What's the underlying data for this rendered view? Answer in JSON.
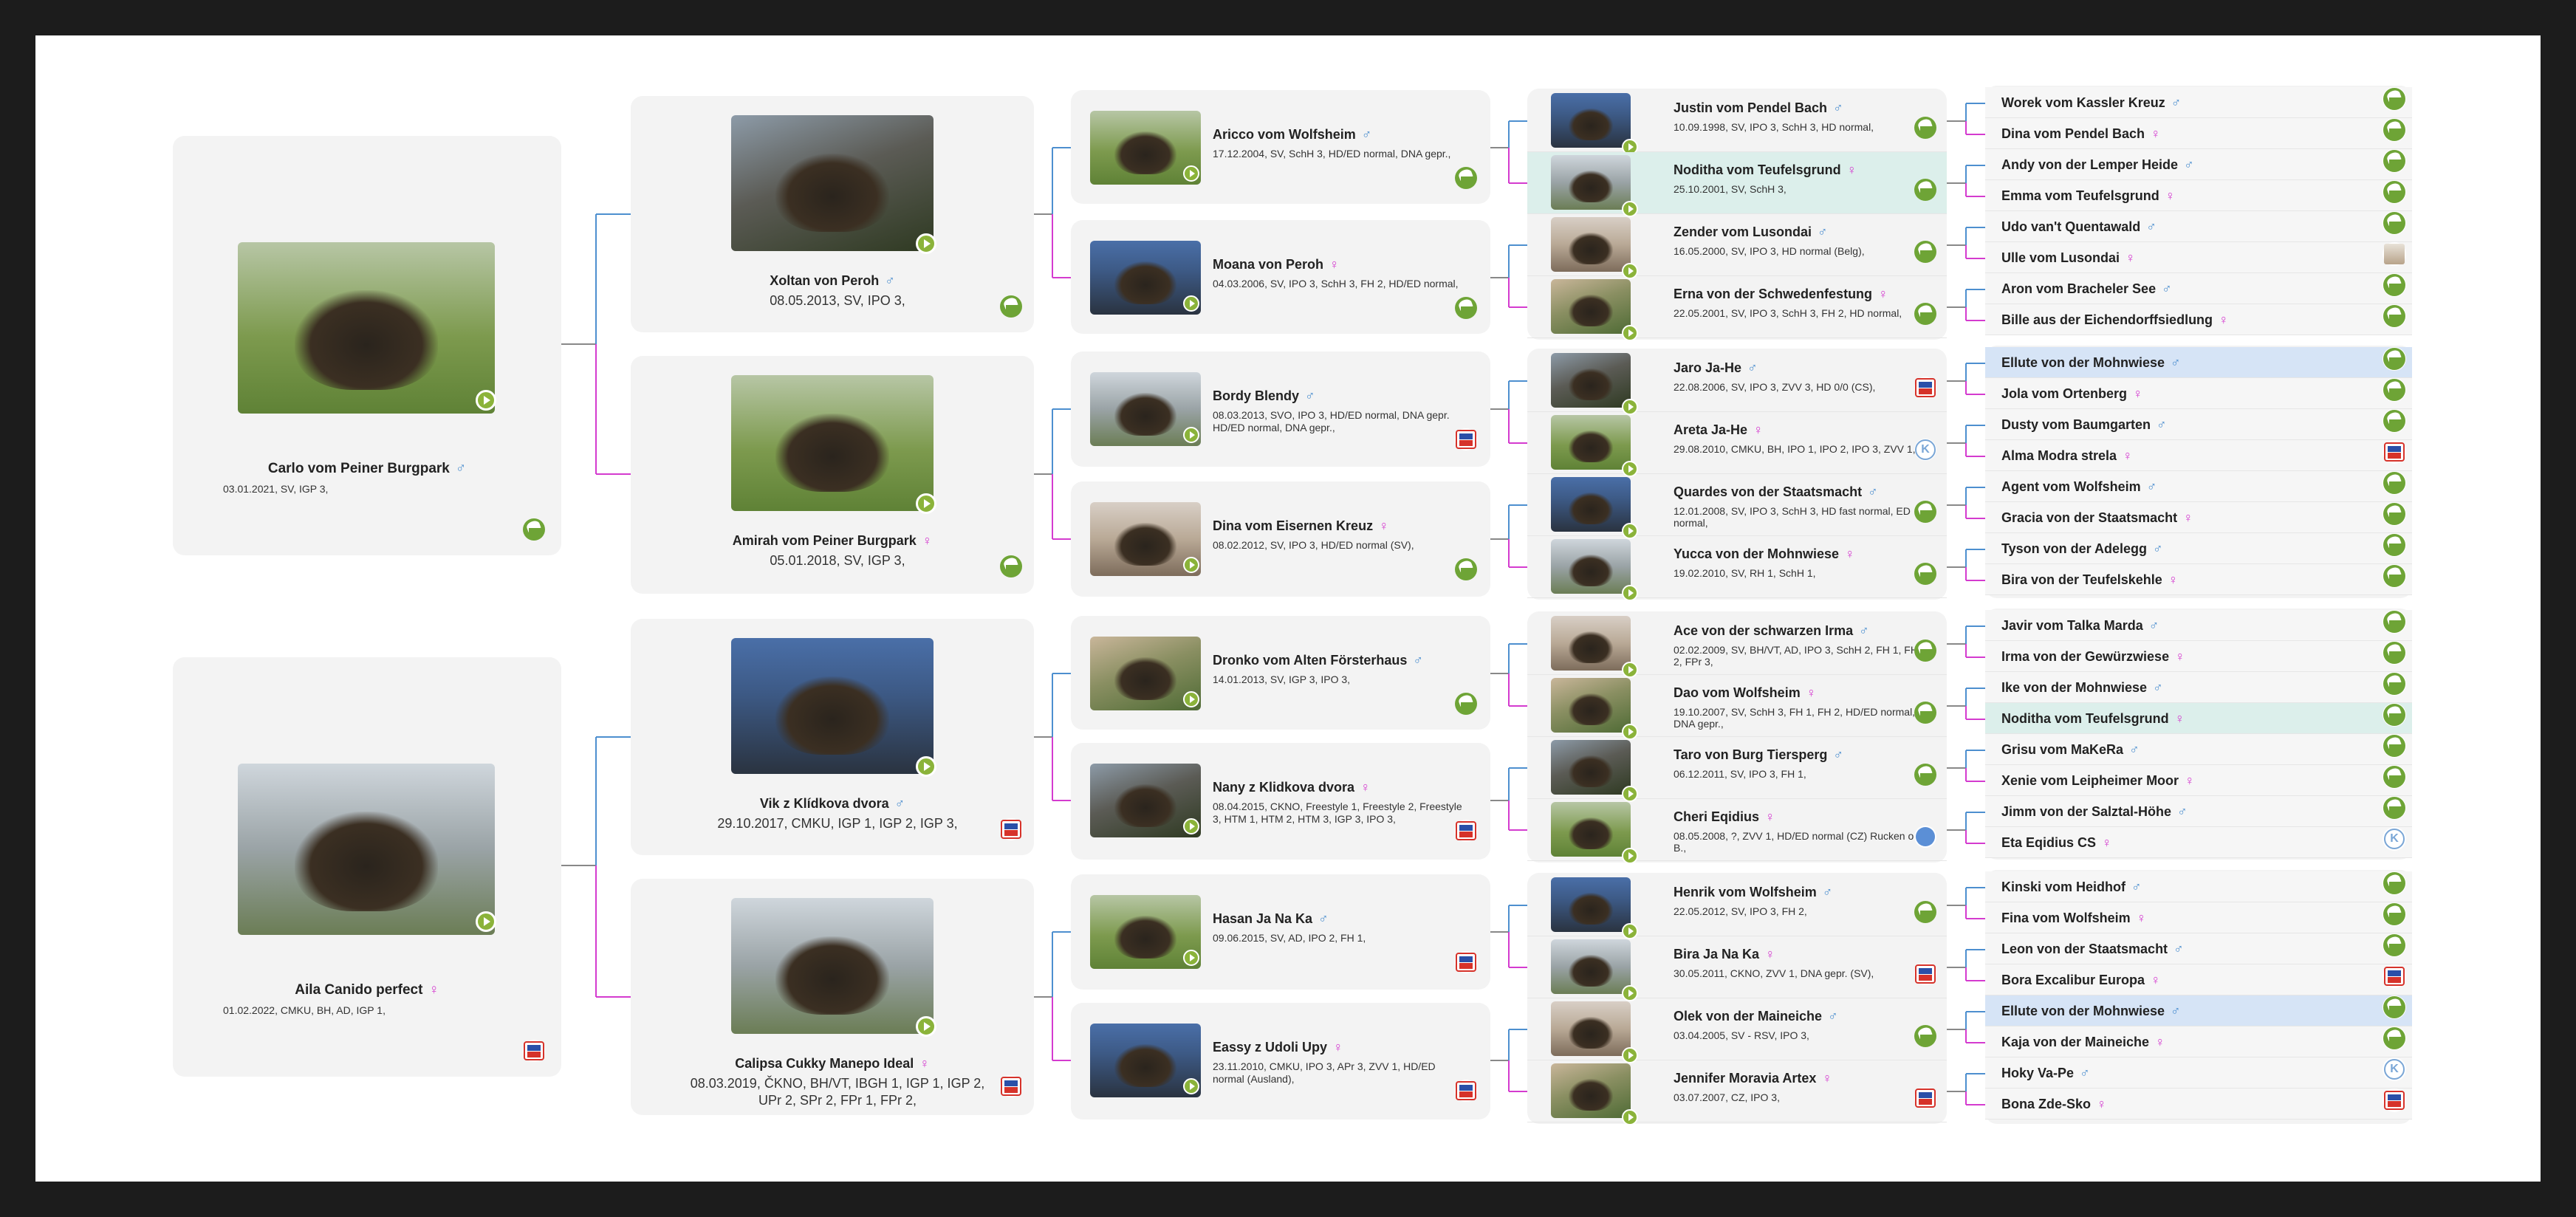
{
  "gen1": [
    {
      "name": "Carlo vom Peiner Burgpark",
      "sex": "♂",
      "info": "03.01.2021, SV, IGP 3,",
      "badge": "sv-icon"
    },
    {
      "name": "Aila Canido perfect",
      "sex": "♀",
      "info": "01.02.2022, CMKU, BH, AD, IGP 1,",
      "badge": "cz-icon"
    }
  ],
  "gen2": [
    {
      "name": "Xoltan von Peroh",
      "sex": "♂",
      "info": "08.05.2013, SV, IPO 3,",
      "badge": "sv-icon"
    },
    {
      "name": "Amirah vom Peiner Burgpark",
      "sex": "♀",
      "info": "05.01.2018, SV, IGP 3,",
      "badge": "sv-icon"
    },
    {
      "name": "Vik z Klídkova dvora",
      "sex": "♂",
      "info": "29.10.2017, CMKU, IGP 1, IGP 2, IGP 3,",
      "badge": "cz-icon"
    },
    {
      "name": "Calipsa Cukky Manepo Ideal",
      "sex": "♀",
      "info": "08.03.2019, ČKNO, BH/VT, IBGH 1, IGP 1, IGP 2, UPr 2, SPr 2, FPr 1, FPr 2,",
      "badge": "cz-icon"
    }
  ],
  "gen3": [
    {
      "name": "Aricco vom Wolfsheim",
      "sex": "♂",
      "info": "17.12.2004, SV, SchH 3, HD/ED normal, DNA gepr.,",
      "badge": "sv-icon"
    },
    {
      "name": "Moana von Peroh",
      "sex": "♀",
      "info": "04.03.2006, SV, IPO 3, SchH 3, FH 2, HD/ED normal,",
      "badge": "sv-icon"
    },
    {
      "name": "Bordy Blendy",
      "sex": "♂",
      "info": "08.03.2013, SVO, IPO 3, HD/ED normal, DNA gepr. HD/ED normal, DNA gepr.,",
      "badge": "cz-icon"
    },
    {
      "name": "Dina vom Eisernen Kreuz",
      "sex": "♀",
      "info": "08.02.2012, SV, IPO 3, HD/ED normal (SV),",
      "badge": "sv-icon"
    },
    {
      "name": "Dronko vom Alten Försterhaus",
      "sex": "♂",
      "info": "14.01.2013, SV, IGP 3, IPO 3,",
      "badge": "sv-icon"
    },
    {
      "name": "Nany z Klidkova dvora",
      "sex": "♀",
      "info": "08.04.2015, CKNO, Freestyle 1, Freestyle 2, Freestyle 3, HTM 1, HTM 2, HTM 3, IGP 3, IPO 3,",
      "badge": "cz-icon"
    },
    {
      "name": "Hasan Ja Na Ka",
      "sex": "♂",
      "info": "09.06.2015, SV, AD, IPO 2, FH 1,",
      "badge": "cz-icon"
    },
    {
      "name": "Eassy z Udoli Upy",
      "sex": "♀",
      "info": "23.11.2010, CMKU, IPO 3, APr 3, ZVV 1, HD/ED normal (Ausland),",
      "badge": "cz-icon"
    }
  ],
  "gen4": [
    {
      "name": "Justin vom Pendel Bach",
      "sex": "♂",
      "info": "10.09.1998, SV, IPO 3, SchH 3, HD normal,",
      "badge": "sv-icon",
      "hl": ""
    },
    {
      "name": "Noditha vom Teufelsgrund",
      "sex": "♀",
      "info": "25.10.2001, SV, SchH 3,",
      "badge": "sv-icon",
      "hl": "teal"
    },
    {
      "name": "Zender vom Lusondai",
      "sex": "♂",
      "info": "16.05.2000, SV, IPO 3, HD normal (Belg),",
      "badge": "sv-icon",
      "hl": ""
    },
    {
      "name": "Erna von der Schwedenfestung",
      "sex": "♀",
      "info": "22.05.2001, SV, IPO 3, SchH 3, FH 2, HD normal,",
      "badge": "sv-icon",
      "hl": ""
    },
    {
      "name": "Jaro Ja-He",
      "sex": "♂",
      "info": "22.08.2006, SV, IPO 3, ZVV 3, HD 0/0 (CS),",
      "badge": "cz-icon",
      "hl": ""
    },
    {
      "name": "Areta Ja-He",
      "sex": "♀",
      "info": "29.08.2010, CMKU, BH, IPO 1, IPO 2, IPO 3, ZVV 1,",
      "badge": "k-icon",
      "hl": ""
    },
    {
      "name": "Quardes von der Staatsmacht",
      "sex": "♂",
      "info": "12.01.2008, SV, IPO 3, SchH 3, HD fast normal, ED normal,",
      "badge": "sv-icon",
      "hl": ""
    },
    {
      "name": "Yucca von der Mohnwiese",
      "sex": "♀",
      "info": "19.02.2010, SV, RH 1, SchH 1,",
      "badge": "sv-icon",
      "hl": ""
    },
    {
      "name": "Ace von der schwarzen Irma",
      "sex": "♂",
      "info": "02.02.2009, SV, BH/VT, AD, IPO 3, SchH 2, FH 1, FH 2, FPr 3,",
      "badge": "sv-icon",
      "hl": ""
    },
    {
      "name": "Dao vom Wolfsheim",
      "sex": "♀",
      "info": "19.10.2007, SV, SchH 3, FH 1, FH 2, HD/ED normal, DNA gepr.,",
      "badge": "sv-icon",
      "hl": ""
    },
    {
      "name": "Taro von Burg Tiersperg",
      "sex": "♂",
      "info": "06.12.2011, SV, IPO 3, FH 1,",
      "badge": "sv-icon",
      "hl": ""
    },
    {
      "name": "Cheri Eqidius",
      "sex": "♀",
      "info": "08.05.2008, ?, ZVV 1, HD/ED normal (CZ) Rucken o. B.,",
      "badge": "blue-icon",
      "hl": ""
    },
    {
      "name": "Henrik vom Wolfsheim",
      "sex": "♂",
      "info": "22.05.2012, SV, IPO 3, FH 2,",
      "badge": "sv-icon",
      "hl": ""
    },
    {
      "name": "Bira Ja Na Ka",
      "sex": "♀",
      "info": "30.05.2011, CKNO, ZVV 1, DNA gepr. (SV),",
      "badge": "cz-icon",
      "hl": ""
    },
    {
      "name": "Olek von der Maineiche",
      "sex": "♂",
      "info": "03.04.2005, SV - RSV, IPO 3,",
      "badge": "sv-icon",
      "hl": ""
    },
    {
      "name": "Jennifer Moravia Artex",
      "sex": "♀",
      "info": "03.07.2007, CZ, IPO 3,",
      "badge": "cz-icon",
      "hl": ""
    }
  ],
  "gen5": [
    {
      "name": "Worek vom Kassler Kreuz",
      "sex": "♂",
      "badge": "sv-icon",
      "hl": ""
    },
    {
      "name": "Dina vom Pendel Bach",
      "sex": "♀",
      "badge": "sv-icon",
      "hl": ""
    },
    {
      "name": "Andy von der Lemper Heide",
      "sex": "♂",
      "badge": "sv-icon",
      "hl": ""
    },
    {
      "name": "Emma vom Teufelsgrund",
      "sex": "♀",
      "badge": "sv-icon",
      "hl": ""
    },
    {
      "name": "Udo van't Quentawald",
      "sex": "♂",
      "badge": "sv-icon",
      "hl": ""
    },
    {
      "name": "Ulle vom Lusondai",
      "sex": "♀",
      "badge": "photo-icon",
      "hl": ""
    },
    {
      "name": "Aron vom Bracheler See",
      "sex": "♂",
      "badge": "sv-icon",
      "hl": ""
    },
    {
      "name": "Bille aus der Eichendorffsiedlung",
      "sex": "♀",
      "badge": "sv-icon",
      "hl": ""
    },
    {
      "name": "Ellute von der Mohnwiese",
      "sex": "♂",
      "badge": "sv-icon",
      "hl": "blue"
    },
    {
      "name": "Jola vom Ortenberg",
      "sex": "♀",
      "badge": "sv-icon",
      "hl": ""
    },
    {
      "name": "Dusty vom Baumgarten",
      "sex": "♂",
      "badge": "sv-icon",
      "hl": ""
    },
    {
      "name": "Alma Modra strela",
      "sex": "♀",
      "badge": "cz-icon",
      "hl": ""
    },
    {
      "name": "Agent vom Wolfsheim",
      "sex": "♂",
      "badge": "sv-icon",
      "hl": ""
    },
    {
      "name": "Gracia von der Staatsmacht",
      "sex": "♀",
      "badge": "sv-icon",
      "hl": ""
    },
    {
      "name": "Tyson von der Adelegg",
      "sex": "♂",
      "badge": "sv-icon",
      "hl": ""
    },
    {
      "name": "Bira von der Teufelskehle",
      "sex": "♀",
      "badge": "sv-icon",
      "hl": ""
    },
    {
      "name": "Javir vom Talka Marda",
      "sex": "♂",
      "badge": "sv-icon",
      "hl": ""
    },
    {
      "name": "Irma von der Gewürzwiese",
      "sex": "♀",
      "badge": "sv-icon",
      "hl": ""
    },
    {
      "name": "Ike von der Mohnwiese",
      "sex": "♂",
      "badge": "sv-icon",
      "hl": ""
    },
    {
      "name": "Noditha vom Teufelsgrund",
      "sex": "♀",
      "badge": "sv-icon",
      "hl": "teal"
    },
    {
      "name": "Grisu vom MaKeRa",
      "sex": "♂",
      "badge": "sv-icon",
      "hl": ""
    },
    {
      "name": "Xenie vom Leipheimer Moor",
      "sex": "♀",
      "badge": "sv-icon",
      "hl": ""
    },
    {
      "name": "Jimm von der Salztal-Höhe",
      "sex": "♂",
      "badge": "sv-icon",
      "hl": ""
    },
    {
      "name": "Eta Eqidius CS",
      "sex": "♀",
      "badge": "k-icon",
      "hl": ""
    },
    {
      "name": "Kinski vom Heidhof",
      "sex": "♂",
      "badge": "sv-icon",
      "hl": ""
    },
    {
      "name": "Fina vom Wolfsheim",
      "sex": "♀",
      "badge": "sv-icon",
      "hl": ""
    },
    {
      "name": "Leon von der Staatsmacht",
      "sex": "♂",
      "badge": "sv-icon",
      "hl": ""
    },
    {
      "name": "Bora Excalibur Europa",
      "sex": "♀",
      "badge": "cz-icon",
      "hl": ""
    },
    {
      "name": "Ellute von der Mohnwiese",
      "sex": "♂",
      "badge": "sv-icon",
      "hl": "blue"
    },
    {
      "name": "Kaja von der Maineiche",
      "sex": "♀",
      "badge": "sv-icon",
      "hl": ""
    },
    {
      "name": "Hoky Va-Pe",
      "sex": "♂",
      "badge": "k-icon",
      "hl": ""
    },
    {
      "name": "Bona Zde-Sko",
      "sex": "♀",
      "badge": "cz-icon",
      "hl": ""
    }
  ],
  "colors": {
    "male": "#4d8fcf",
    "female": "#d43bcf",
    "play": "#8bb33a",
    "card": "#f3f3f3",
    "highlight_blue": "#d6e4f6",
    "highlight_teal": "#dcefeb"
  }
}
